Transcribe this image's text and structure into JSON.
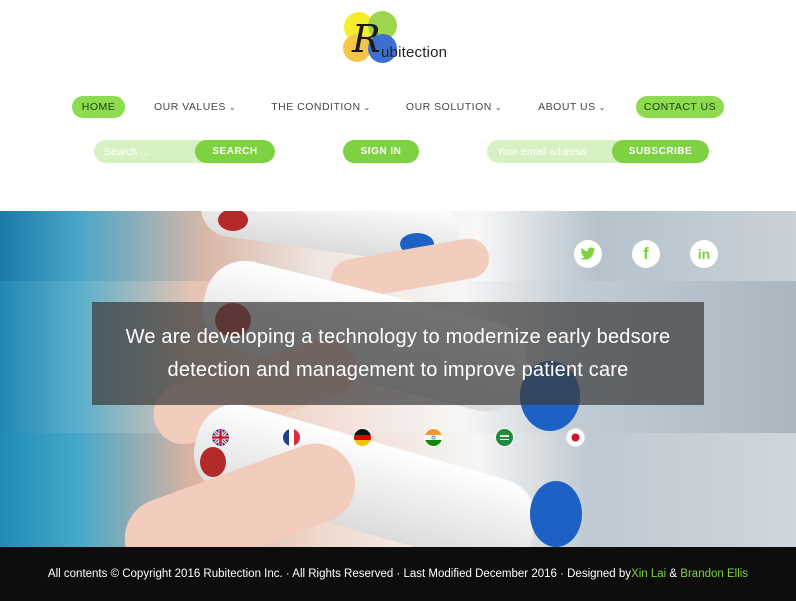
{
  "logo": {
    "initial": "R",
    "wordmark": "ubitection"
  },
  "nav": {
    "home": "HOME",
    "values": "OUR VALUES",
    "condition": "THE CONDITION",
    "solution": "OUR SOLUTION",
    "about": "ABOUT US",
    "contact": "CONTACT US",
    "chevron": "⌄"
  },
  "search": {
    "placeholder": "Search ...",
    "button": "SEARCH"
  },
  "signin": {
    "label": "SIGN IN"
  },
  "subscribe": {
    "placeholder": "Your email address",
    "button": "SUBSCRIBE"
  },
  "social": {
    "twitter": "twitter-icon",
    "facebook": "facebook-icon",
    "linkedin": "linkedin-icon",
    "fb_glyph": "f",
    "li_glyph": "in"
  },
  "hero": {
    "headline": "We are developing a technology to modernize early bedsore detection and management to improve patient care"
  },
  "flags": [
    "uk",
    "france",
    "germany",
    "india",
    "saudi-arabia",
    "japan"
  ],
  "footer": {
    "text": "All contents © Copyright 2016 Rubitection Inc. · All Rights Reserved · Last Modified December 2016 · Designed by ",
    "author1": "Xin Lai",
    "amp": " & ",
    "author2": "Brandon Ellis"
  },
  "colors": {
    "accent": "#7ed141",
    "footer_bg": "#0d0d0d"
  }
}
